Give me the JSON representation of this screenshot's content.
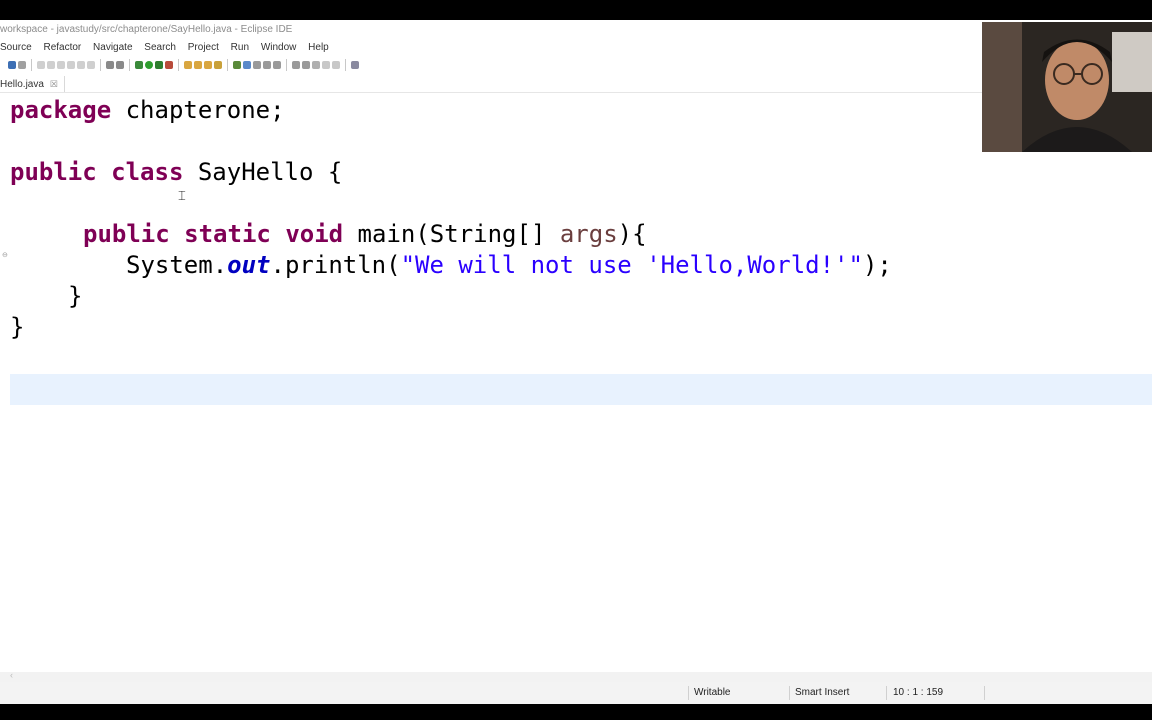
{
  "window": {
    "title": "workspace - javastudy/src/chapterone/SayHello.java - Eclipse IDE"
  },
  "menubar": {
    "items": [
      "Source",
      "Refactor",
      "Navigate",
      "Search",
      "Project",
      "Run",
      "Window",
      "Help"
    ]
  },
  "editor_tab": {
    "label": "Hello.java",
    "close": "☒"
  },
  "code": {
    "line1_kw": "package",
    "line1_rest": " chapterone;",
    "line2_kw1": "public",
    "line2_kw2": "class",
    "line2_rest": " SayHello {",
    "line3_kw1": "public",
    "line3_kw2": "static",
    "line3_kw3": "void",
    "line3_mid": " main(String[] ",
    "line3_var": "args",
    "line3_end": "){",
    "line4_start": "System.",
    "line4_field": "out",
    "line4_mid": ".println(",
    "line4_str": "\"We will not use 'Hello,World!'\"",
    "line4_end": ");",
    "line5": "}",
    "line6": "}"
  },
  "status": {
    "writable": "Writable",
    "insert_mode": "Smart Insert",
    "position": "10 : 1 : 159"
  },
  "colors": {
    "keyword": "#7f0055",
    "string": "#2a00ff",
    "field": "#0000c0",
    "variable": "#6a3e3e",
    "current_line": "#e8f2fe"
  },
  "icons": {
    "webcam": "presenter-webcam-overlay"
  }
}
